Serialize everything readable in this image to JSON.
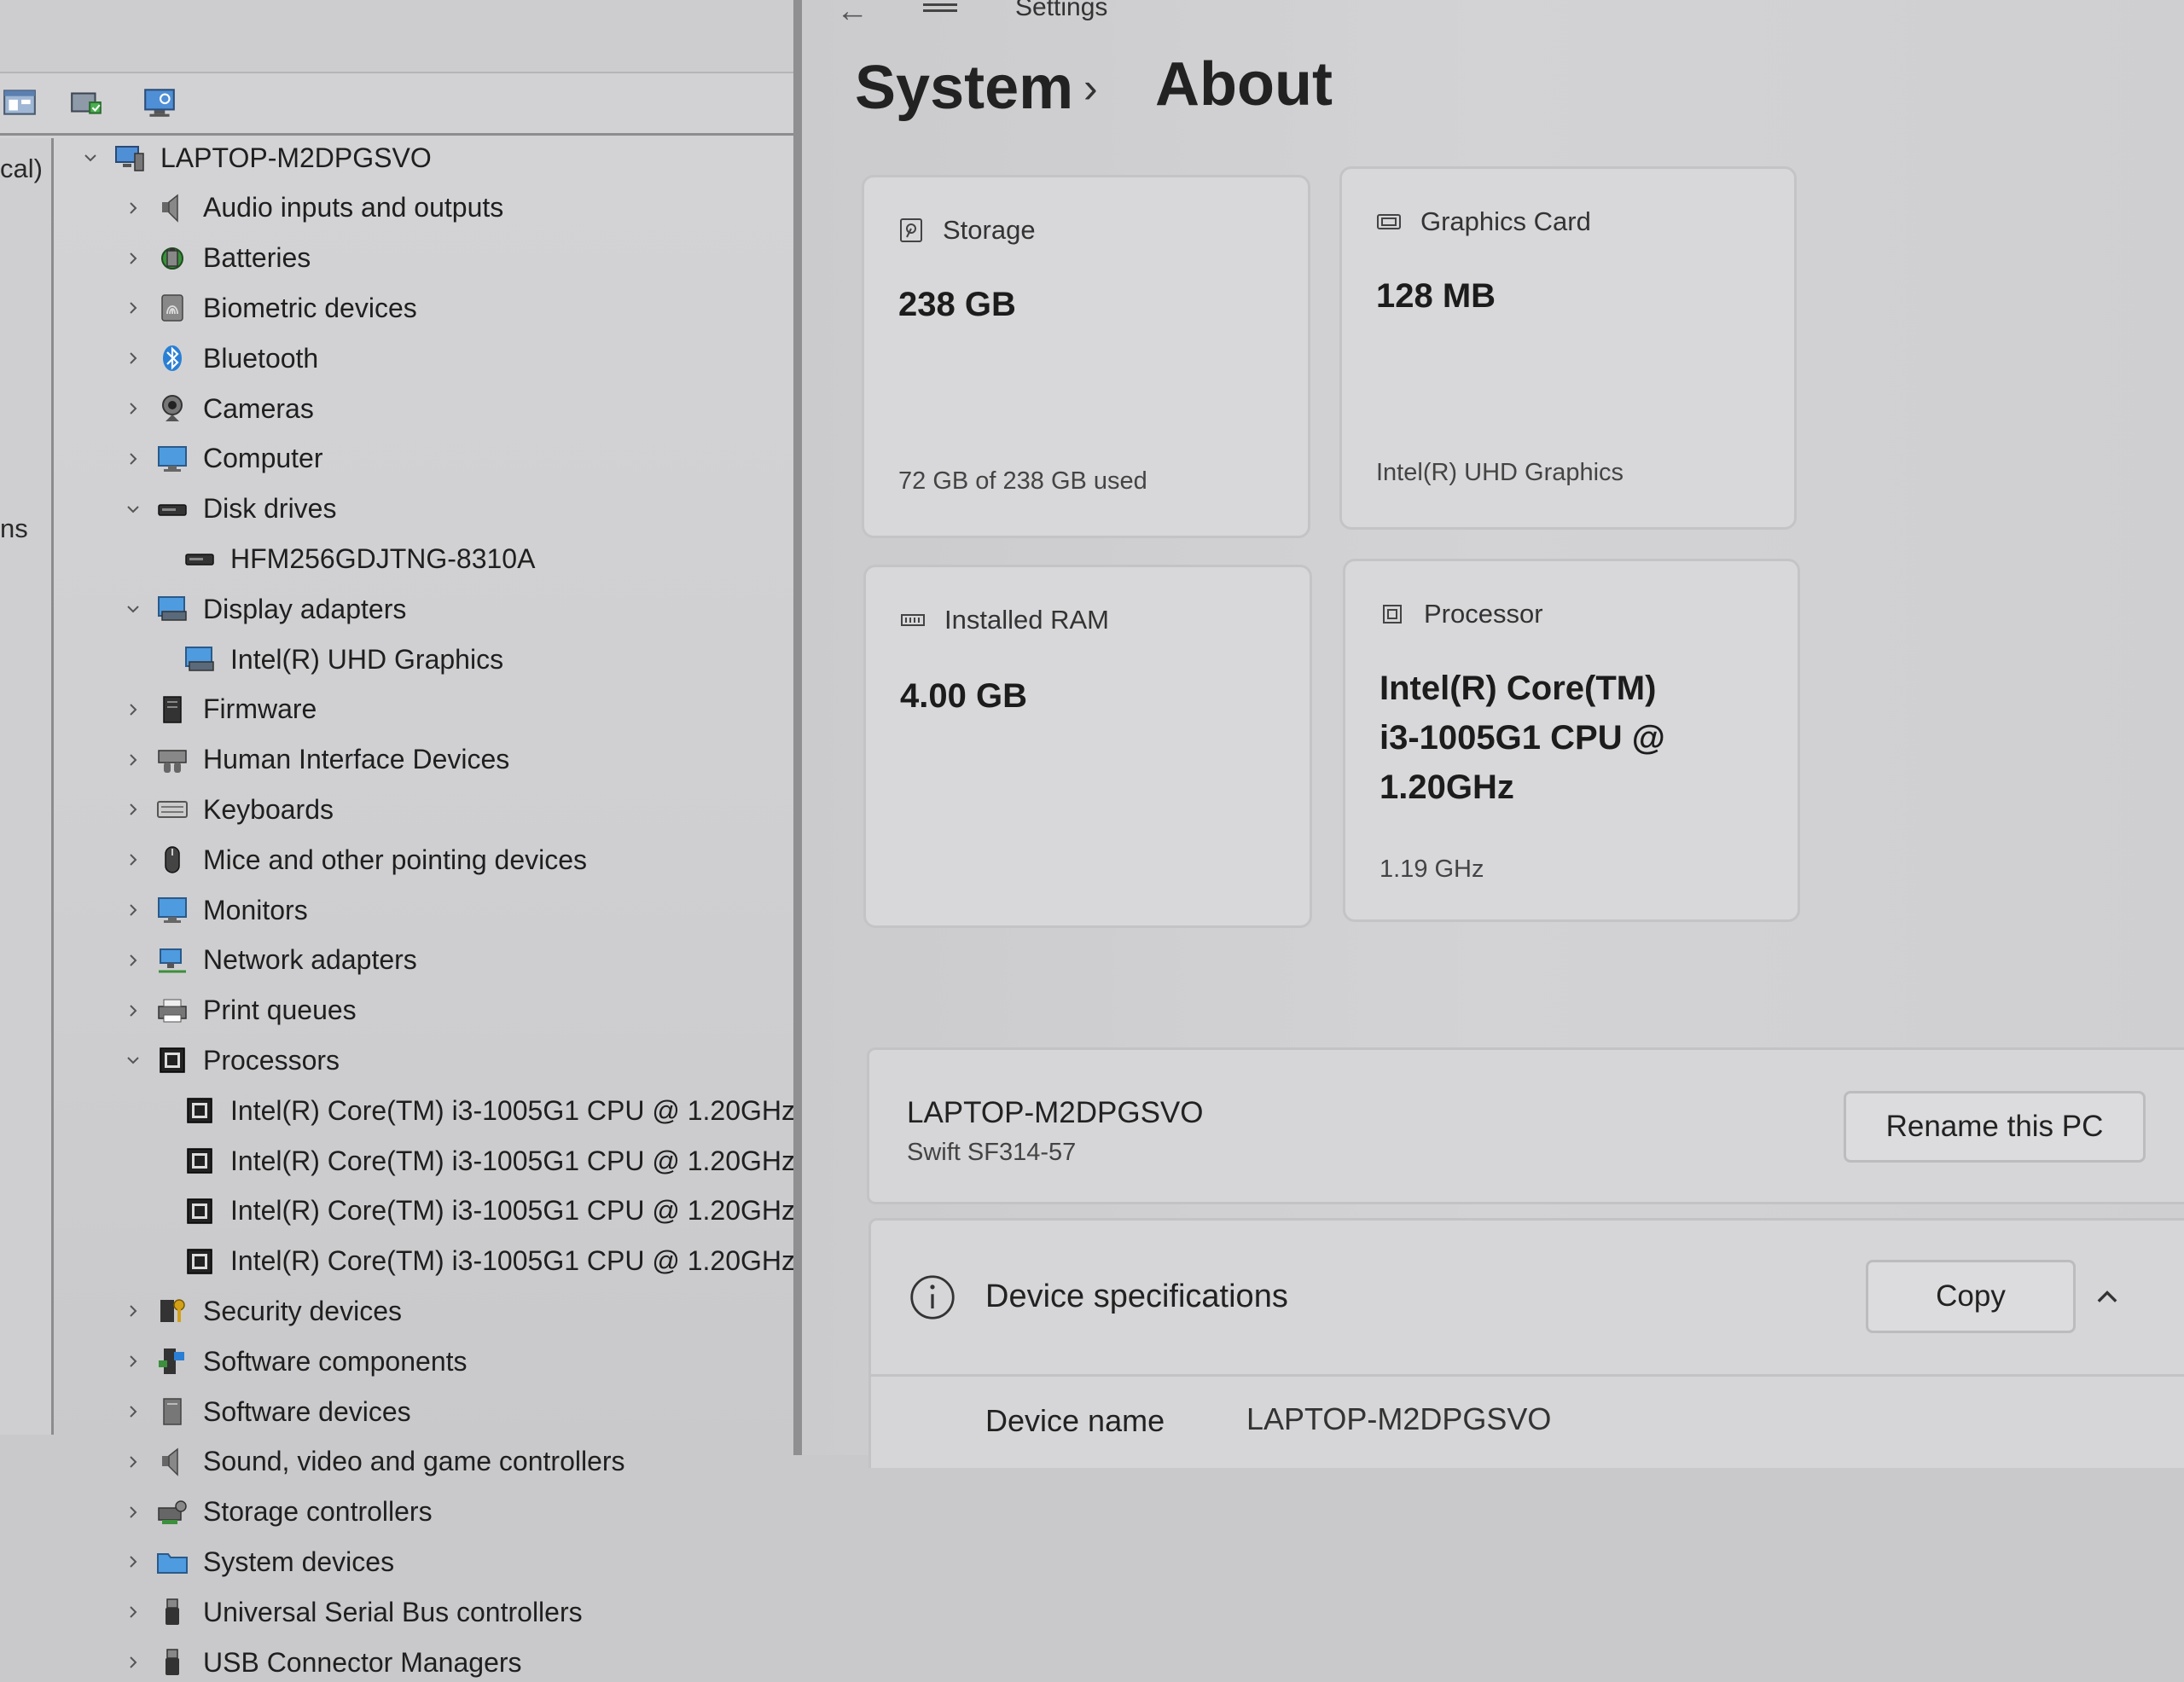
{
  "device_manager": {
    "left_pane": {
      "top_label": "cal)",
      "mid_label": "ns"
    },
    "root": "LAPTOP-M2DPGSVO",
    "categories": [
      {
        "label": "Audio inputs and outputs",
        "icon": "speaker-icon"
      },
      {
        "label": "Batteries",
        "icon": "battery-icon"
      },
      {
        "label": "Biometric devices",
        "icon": "fingerprint-icon"
      },
      {
        "label": "Bluetooth",
        "icon": "bluetooth-icon"
      },
      {
        "label": "Cameras",
        "icon": "camera-icon"
      },
      {
        "label": "Computer",
        "icon": "monitor-icon"
      },
      {
        "label": "Disk drives",
        "icon": "disk-icon",
        "expanded": true,
        "children": [
          "HFM256GDJTNG-8310A"
        ]
      },
      {
        "label": "Display adapters",
        "icon": "display-adapter-icon",
        "expanded": true,
        "children": [
          "Intel(R) UHD Graphics"
        ]
      },
      {
        "label": "Firmware",
        "icon": "firmware-icon"
      },
      {
        "label": "Human Interface Devices",
        "icon": "hid-icon"
      },
      {
        "label": "Keyboards",
        "icon": "keyboard-icon"
      },
      {
        "label": "Mice and other pointing devices",
        "icon": "mouse-icon"
      },
      {
        "label": "Monitors",
        "icon": "monitor-icon"
      },
      {
        "label": "Network adapters",
        "icon": "network-icon"
      },
      {
        "label": "Print queues",
        "icon": "printer-icon"
      },
      {
        "label": "Processors",
        "icon": "chip-icon",
        "expanded": true,
        "children": [
          "Intel(R) Core(TM) i3-1005G1 CPU @ 1.20GHz",
          "Intel(R) Core(TM) i3-1005G1 CPU @ 1.20GHz",
          "Intel(R) Core(TM) i3-1005G1 CPU @ 1.20GHz",
          "Intel(R) Core(TM) i3-1005G1 CPU @ 1.20GHz"
        ]
      },
      {
        "label": "Security devices",
        "icon": "key-icon"
      },
      {
        "label": "Software components",
        "icon": "software-components-icon"
      },
      {
        "label": "Software devices",
        "icon": "software-device-icon"
      },
      {
        "label": "Sound, video and game controllers",
        "icon": "speaker-icon"
      },
      {
        "label": "Storage controllers",
        "icon": "storage-controller-icon"
      },
      {
        "label": "System devices",
        "icon": "folder-icon"
      },
      {
        "label": "Universal Serial Bus controllers",
        "icon": "usb-icon"
      },
      {
        "label": "USB Connector Managers",
        "icon": "usb-icon"
      }
    ]
  },
  "settings": {
    "app_title": "Settings",
    "breadcrumb": {
      "parent": "System",
      "separator": "›",
      "current": "About"
    },
    "cards": {
      "storage": {
        "title": "Storage",
        "value": "238 GB",
        "sub": "72 GB of 238 GB used"
      },
      "graphics": {
        "title": "Graphics Card",
        "value": "128 MB",
        "sub": "Intel(R) UHD Graphics"
      },
      "ram": {
        "title": "Installed RAM",
        "value": "4.00 GB",
        "sub": ""
      },
      "processor": {
        "title": "Processor",
        "value_lines": [
          "Intel(R) Core(TM)",
          "i3-1005G1 CPU @",
          "1.20GHz"
        ],
        "sub": "1.19 GHz"
      }
    },
    "pc": {
      "name": "LAPTOP-M2DPGSVO",
      "model": "Swift SF314-57",
      "rename_label": "Rename this PC"
    },
    "specs": {
      "title": "Device specifications",
      "copy_label": "Copy",
      "rows": [
        {
          "label": "Device name",
          "value": "LAPTOP-M2DPGSVO"
        }
      ]
    }
  },
  "colors": {
    "accent_blue": "#2a7fd4",
    "background": "#c9c9cb",
    "card": "#d8d8da"
  }
}
